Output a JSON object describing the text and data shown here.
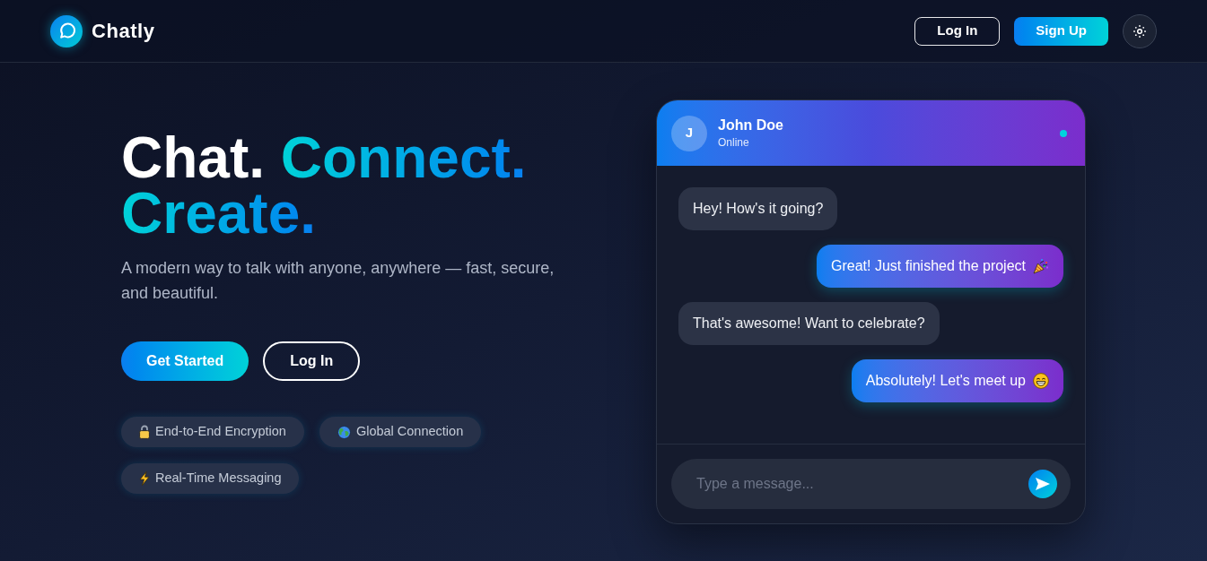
{
  "header": {
    "brand": "Chatly",
    "buttons": [
      {
        "label": "Log In",
        "kind": "outline"
      },
      {
        "label": "Sign Up",
        "kind": "filled"
      }
    ]
  },
  "hero": {
    "headline": [
      {
        "text": "Chat.",
        "kind": "plain"
      },
      {
        "text": "Connect.",
        "kind": "accent"
      },
      {
        "text": "Create.",
        "kind": "accent"
      }
    ],
    "subtitle": "A modern way to talk with anyone, anywhere — fast, secure, and beautiful.",
    "buttons": [
      {
        "label": "Get Started",
        "kind": "filled"
      },
      {
        "label": "Log In",
        "kind": "outline"
      }
    ],
    "features": [
      {
        "label": "End-to-End Encryption",
        "kind": "lock"
      },
      {
        "label": "Global Connection",
        "kind": "globe"
      },
      {
        "label": "Real-Time Messaging",
        "kind": "bolt"
      }
    ]
  },
  "chat": {
    "contact": {
      "initial": "J",
      "name": "John Doe",
      "status": "Online",
      "online": true
    },
    "messages": [
      {
        "text": "Hey! How's it going?",
        "kind": "received"
      },
      {
        "text": "Great! Just finished the project",
        "kind": "sent",
        "emoji": {
          "kind": "party"
        }
      },
      {
        "text": "That's awesome! Want to celebrate?",
        "kind": "received"
      },
      {
        "text": "Absolutely! Let's meet up",
        "kind": "sent",
        "emoji": {
          "kind": "grin"
        }
      }
    ],
    "composer": {
      "placeholder": "Type a message..."
    }
  }
}
